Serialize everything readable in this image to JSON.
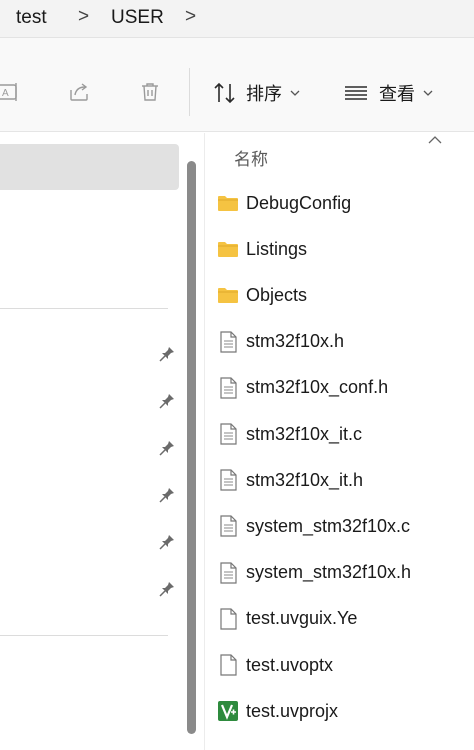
{
  "breadcrumb": {
    "items": [
      "test",
      "USER"
    ],
    "separator": ">"
  },
  "toolbar": {
    "sort_label": "排序",
    "view_label": "查看",
    "icons": [
      "rename-icon",
      "share-icon",
      "delete-icon",
      "sort-icon",
      "view-icon"
    ]
  },
  "file_list": {
    "column_name": "名称",
    "items": [
      {
        "name": "DebugConfig",
        "type": "folder"
      },
      {
        "name": "Listings",
        "type": "folder"
      },
      {
        "name": "Objects",
        "type": "folder"
      },
      {
        "name": "stm32f10x.h",
        "type": "file"
      },
      {
        "name": "stm32f10x_conf.h",
        "type": "file"
      },
      {
        "name": "stm32f10x_it.c",
        "type": "file"
      },
      {
        "name": "stm32f10x_it.h",
        "type": "file"
      },
      {
        "name": "system_stm32f10x.c",
        "type": "file"
      },
      {
        "name": "system_stm32f10x.h",
        "type": "file"
      },
      {
        "name": "test.uvguix.Ye",
        "type": "blank-file"
      },
      {
        "name": "test.uvoptx",
        "type": "blank-file"
      },
      {
        "name": "test.uvprojx",
        "type": "keil-project"
      }
    ]
  },
  "colors": {
    "folder": "#f5c342",
    "keil": "#2e8b3e",
    "selection": "#e1e1e1",
    "scrollbar": "#8a8a8a"
  }
}
